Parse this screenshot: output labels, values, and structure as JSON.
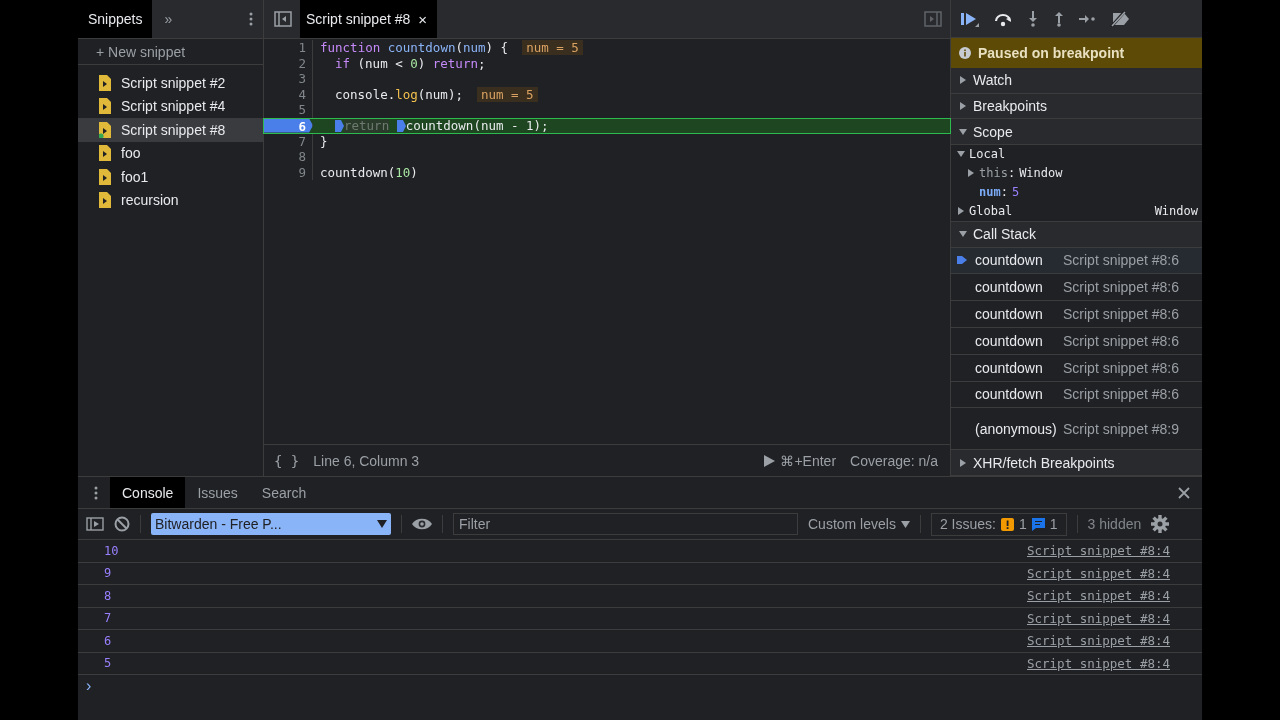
{
  "sidebar": {
    "tab": "Snippets",
    "more": "»",
    "new_snippet": "+ New snippet",
    "items": [
      {
        "name": "Script snippet #2",
        "selected": false,
        "running": false
      },
      {
        "name": "Script snippet #4",
        "selected": false,
        "running": false
      },
      {
        "name": "Script snippet #8",
        "selected": true,
        "running": true
      },
      {
        "name": "foo",
        "selected": false,
        "running": false
      },
      {
        "name": "foo1",
        "selected": false,
        "running": false
      },
      {
        "name": "recursion",
        "selected": false,
        "running": false
      }
    ]
  },
  "editor": {
    "tabs": [
      {
        "label": "Script snippet #8",
        "close": "×",
        "selected": true
      }
    ],
    "lines": [
      {
        "number": "1",
        "current": false,
        "indented": false,
        "tokens": [
          {
            "t": "function",
            "kind": "keyword"
          },
          {
            "t": "countdown",
            "kind": "def",
            "space": true
          },
          {
            "t": "(",
            "kind": "plain"
          },
          {
            "t": "num",
            "kind": "def"
          },
          {
            "t": ") {",
            "kind": "plain"
          }
        ],
        "inline_value": "num = 5"
      },
      {
        "number": "2",
        "current": false,
        "indented": true,
        "tokens": [
          {
            "t": "if",
            "kind": "keyword"
          },
          {
            "t": "(num <",
            "kind": "plain",
            "space": true
          },
          {
            "t": "0",
            "kind": "number",
            "space": true
          },
          {
            "t": ")",
            "kind": "plain"
          },
          {
            "t": "return",
            "kind": "keyword",
            "space": true
          },
          {
            "t": ";",
            "kind": "plain"
          }
        ]
      },
      {
        "number": "3",
        "current": false
      },
      {
        "number": "4",
        "current": false,
        "indented": true,
        "tokens": [
          {
            "t": "console.",
            "kind": "plain"
          },
          {
            "t": "log",
            "kind": "property"
          },
          {
            "t": "(num);",
            "kind": "plain"
          }
        ],
        "inline_value": "num = 5"
      },
      {
        "number": "5",
        "current": false
      },
      {
        "number": "6",
        "current": true,
        "indented": true,
        "tokens": [
          {
            "t": "return",
            "kind": "dim",
            "stop": true
          },
          {
            "t": "countdown(num - 1);",
            "kind": "plain",
            "stop": true,
            "space": true
          }
        ]
      },
      {
        "number": "7",
        "current": false,
        "indented": false,
        "tokens": [
          {
            "t": "}",
            "kind": "plain"
          }
        ]
      },
      {
        "number": "8",
        "current": false
      },
      {
        "number": "9",
        "current": false,
        "indented": false,
        "tokens": [
          {
            "t": "countdown(",
            "kind": "plain"
          },
          {
            "t": "10",
            "kind": "number"
          },
          {
            "t": ")",
            "kind": "plain"
          }
        ]
      }
    ],
    "status": {
      "format": "{ }",
      "position": "Line 6, Column 3",
      "run": "⌘+Enter",
      "coverage": "Coverage: n/a"
    }
  },
  "debugger": {
    "banner": "Paused on breakpoint",
    "sections": [
      {
        "title": "Watch",
        "expanded": false
      },
      {
        "title": "Breakpoints",
        "expanded": false
      },
      {
        "title": "Scope",
        "expanded": true,
        "scopes": [
          {
            "name": "Local",
            "expanded": true,
            "children": [
              {
                "name": "this",
                "colon": ":",
                "value": "Window",
                "expandable": true
              },
              {
                "name": "num",
                "colon": ":",
                "value": "5",
                "expandable": false
              }
            ]
          },
          {
            "name": "Global",
            "expanded": false,
            "value": "Window"
          }
        ]
      },
      {
        "title": "Call Stack",
        "expanded": true,
        "frames": [
          {
            "name": "countdown",
            "location": "Script snippet #8:6",
            "selected": true
          },
          {
            "name": "countdown",
            "location": "Script snippet #8:6",
            "selected": false
          },
          {
            "name": "countdown",
            "location": "Script snippet #8:6",
            "selected": false
          },
          {
            "name": "countdown",
            "location": "Script snippet #8:6",
            "selected": false
          },
          {
            "name": "countdown",
            "location": "Script snippet #8:6",
            "selected": false
          },
          {
            "name": "countdown",
            "location": "Script snippet #8:6",
            "selected": false
          },
          {
            "name": "(anonymous)",
            "location": "Script snippet #8:9",
            "selected": false
          }
        ]
      },
      {
        "title": "XHR/fetch Breakpoints",
        "expanded": false
      }
    ]
  },
  "drawer": {
    "tabs": [
      {
        "label": "Console",
        "selected": true
      },
      {
        "label": "Issues",
        "selected": false
      },
      {
        "label": "Search",
        "selected": false
      }
    ],
    "context": "Bitwarden - Free P...",
    "filter_placeholder": "Filter",
    "levels": "Custom levels",
    "issues_label": "2 Issues:",
    "warnings": "1",
    "infos": "1",
    "hidden": "3 hidden",
    "messages": [
      {
        "value": "10",
        "source": "Script snippet #8:4"
      },
      {
        "value": "9",
        "source": "Script snippet #8:4"
      },
      {
        "value": "8",
        "source": "Script snippet #8:4"
      },
      {
        "value": "7",
        "source": "Script snippet #8:4"
      },
      {
        "value": "6",
        "source": "Script snippet #8:4"
      },
      {
        "value": "5",
        "source": "Script snippet #8:4"
      }
    ],
    "prompt": "›"
  }
}
